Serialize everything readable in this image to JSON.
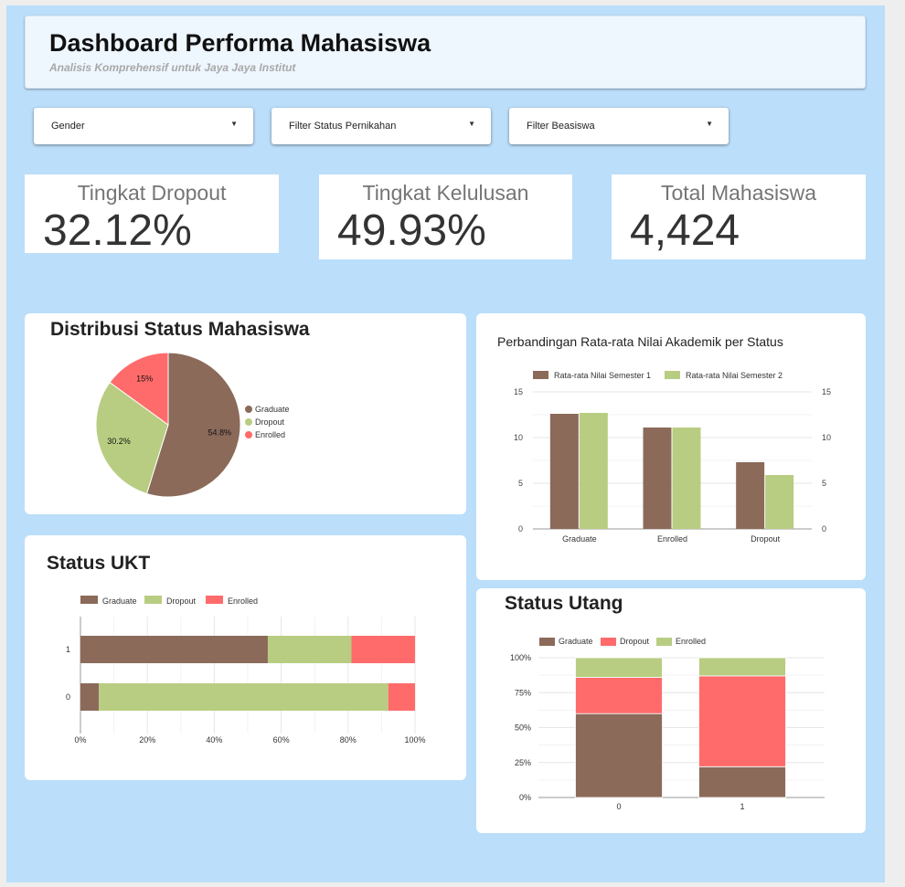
{
  "header": {
    "title": "Dashboard Performa Mahasiswa",
    "subtitle": "Analisis Komprehensif untuk Jaya Jaya Institut"
  },
  "filters": [
    {
      "label": "Gender"
    },
    {
      "label": "Filter Status Pernikahan"
    },
    {
      "label": "Filter Beasiswa"
    }
  ],
  "kpis": [
    {
      "title": "Tingkat Dropout",
      "value": "32.12%"
    },
    {
      "title": "Tingkat Kelulusan",
      "value": "49.93%"
    },
    {
      "title": "Total Mahasiswa",
      "value": "4,424"
    }
  ],
  "colors": {
    "graduate": "#8b6a5a",
    "dropout": "#b8cd82",
    "enrolled": "#ff6b6b",
    "canvas": "#bbdefa"
  },
  "chart_data": [
    {
      "id": "status_pie",
      "type": "pie",
      "title": "Distribusi Status Mahasiswa",
      "legend_position": "right",
      "slices": [
        {
          "label": "Graduate",
          "value": 54.8,
          "display": "54.8%",
          "color": "#8b6a5a"
        },
        {
          "label": "Dropout",
          "value": 30.2,
          "display": "30.2%",
          "color": "#b8cd82"
        },
        {
          "label": "Enrolled",
          "value": 15,
          "display": "15%",
          "color": "#ff6b6b"
        }
      ]
    },
    {
      "id": "nilai_bar",
      "type": "bar",
      "title": "Perbandingan Rata-rata Nilai Akademik per Status",
      "categories": [
        "Graduate",
        "Enrolled",
        "Dropout"
      ],
      "series": [
        {
          "name": "Rata-rata Nilai Semester 1",
          "values": [
            12.6,
            11.1,
            7.3
          ],
          "color": "#8b6a5a"
        },
        {
          "name": "Rata-rata Nilai Semester 2",
          "values": [
            12.7,
            11.1,
            5.9
          ],
          "color": "#b8cd82"
        }
      ],
      "ylim": [
        0,
        15
      ],
      "yticks": [
        "0",
        "5",
        "10",
        "15"
      ],
      "yticks_right": [
        "0",
        "5",
        "10",
        "15"
      ],
      "legend_position": "top",
      "grid": true
    },
    {
      "id": "ukt_bar",
      "type": "bar",
      "orientation": "horizontal",
      "stacked": "percent",
      "title": "Status UKT",
      "categories": [
        "1",
        "0"
      ],
      "series": [
        {
          "name": "Graduate",
          "values": [
            56,
            5.5
          ],
          "color": "#8b6a5a"
        },
        {
          "name": "Dropout",
          "values": [
            25,
            86.5
          ],
          "color": "#b8cd82"
        },
        {
          "name": "Enrolled",
          "values": [
            19,
            8
          ],
          "color": "#ff6b6b"
        }
      ],
      "xticks": [
        "0%",
        "20%",
        "40%",
        "60%",
        "80%",
        "100%"
      ],
      "legend_position": "top",
      "grid": true
    },
    {
      "id": "utang_bar",
      "type": "bar",
      "stacked": "percent",
      "title": "Status Utang",
      "categories": [
        "0",
        "1"
      ],
      "series": [
        {
          "name": "Graduate",
          "values": [
            60,
            22
          ],
          "color": "#8b6a5a"
        },
        {
          "name": "Dropout",
          "values": [
            26,
            65
          ],
          "color": "#ff6b6b"
        },
        {
          "name": "Enrolled",
          "values": [
            14,
            13
          ],
          "color": "#b8cd82"
        }
      ],
      "yticks": [
        "0%",
        "25%",
        "50%",
        "75%",
        "100%"
      ],
      "legend_position": "top",
      "grid": true
    }
  ]
}
